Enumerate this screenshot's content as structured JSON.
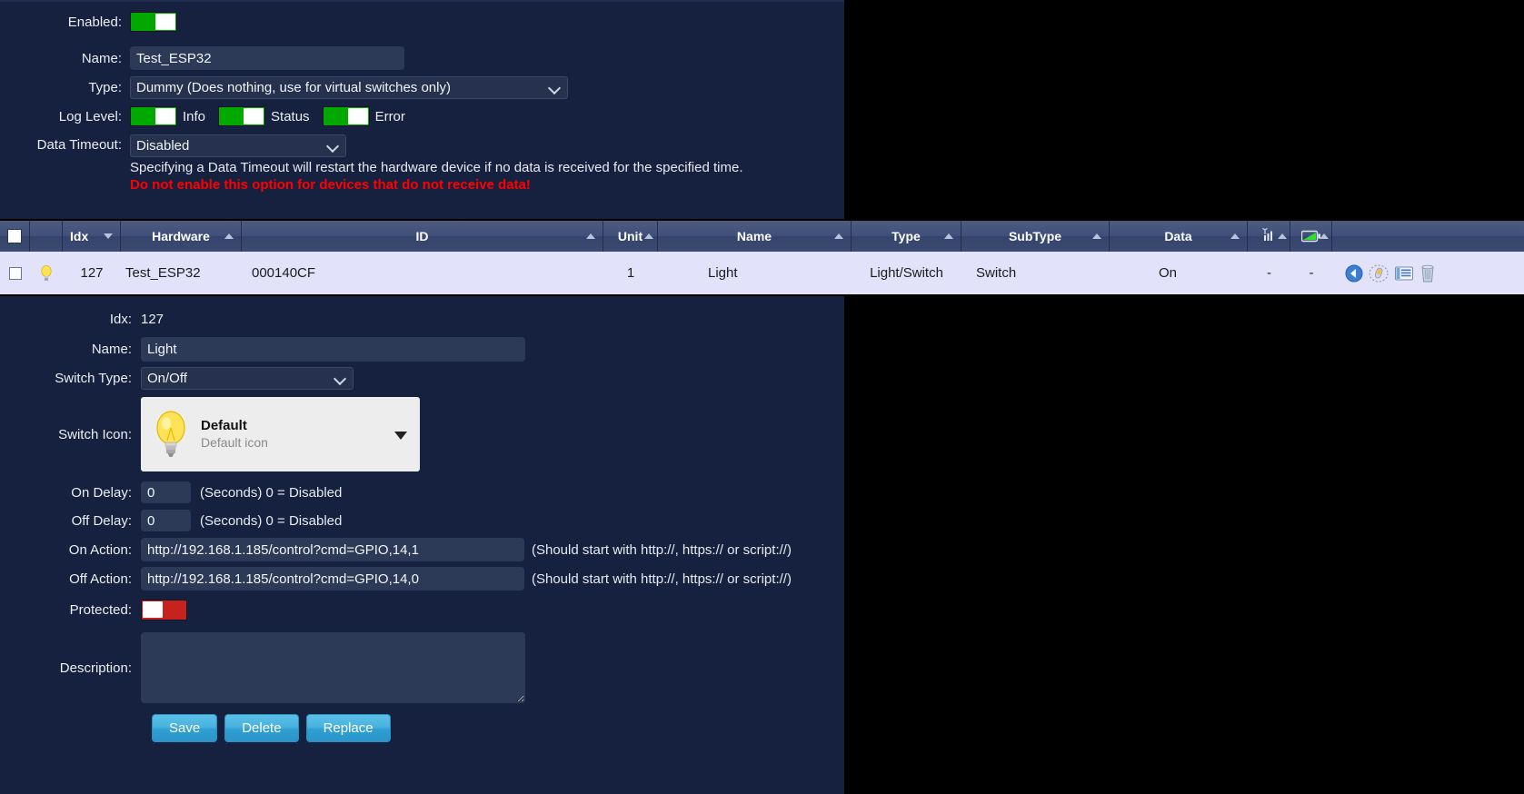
{
  "hardware_form": {
    "enabled": {
      "label": "Enabled:",
      "state": "on"
    },
    "name": {
      "label": "Name:",
      "value": "Test_ESP32"
    },
    "type": {
      "label": "Type:",
      "value": "Dummy (Does nothing, use for virtual switches only)"
    },
    "log_level": {
      "label": "Log Level:",
      "items": [
        {
          "label": "Info",
          "state": "on"
        },
        {
          "label": "Status",
          "state": "on"
        },
        {
          "label": "Error",
          "state": "on"
        }
      ]
    },
    "data_timeout": {
      "label": "Data Timeout:",
      "value": "Disabled",
      "hint": "Specifying a Data Timeout will restart the hardware device if no data is received for the specified time.",
      "warning": "Do not enable this option for devices that do not receive data!"
    }
  },
  "devices_table": {
    "columns": [
      {
        "key": "check",
        "label": "",
        "icon": "checkbox-icon",
        "sort": "none"
      },
      {
        "key": "status",
        "label": "",
        "icon": "",
        "sort": "none"
      },
      {
        "key": "idx",
        "label": "Idx",
        "sort": "desc"
      },
      {
        "key": "hardware",
        "label": "Hardware",
        "sort": "asc"
      },
      {
        "key": "id",
        "label": "ID",
        "sort": "asc"
      },
      {
        "key": "unit",
        "label": "Unit",
        "sort": "asc"
      },
      {
        "key": "name",
        "label": "Name",
        "sort": "asc"
      },
      {
        "key": "type",
        "label": "Type",
        "sort": "asc"
      },
      {
        "key": "subtype",
        "label": "SubType",
        "sort": "asc"
      },
      {
        "key": "data",
        "label": "Data",
        "sort": "asc"
      },
      {
        "key": "signal",
        "label": "",
        "icon": "signal-bars-icon",
        "sort": "asc"
      },
      {
        "key": "battery",
        "label": "",
        "icon": "battery-icon",
        "sort": "asc"
      },
      {
        "key": "actions",
        "label": "",
        "sort": "none"
      }
    ],
    "rows": [
      {
        "checked": false,
        "status_icon": "lightbulb-icon",
        "idx": "127",
        "hardware": "Test_ESP32",
        "id": "000140CF",
        "unit": "1",
        "name": "Light",
        "type": "Light/Switch",
        "subtype": "Switch",
        "data": "On",
        "signal": "-",
        "battery": "-",
        "actions": [
          "back-arrow-icon",
          "edit-pencil-icon",
          "log-list-icon",
          "delete-trash-icon"
        ]
      }
    ]
  },
  "device_form": {
    "idx": {
      "label": "Idx:",
      "value": "127"
    },
    "name": {
      "label": "Name:",
      "value": "Light"
    },
    "switch_type": {
      "label": "Switch Type:",
      "value": "On/Off"
    },
    "switch_icon": {
      "label": "Switch Icon:",
      "title": "Default",
      "subtitle": "Default icon",
      "icon": "lightbulb-icon"
    },
    "on_delay": {
      "label": "On Delay:",
      "value": "0",
      "hint": "(Seconds) 0 = Disabled"
    },
    "off_delay": {
      "label": "Off Delay:",
      "value": "0",
      "hint": "(Seconds) 0 = Disabled"
    },
    "on_action": {
      "label": "On Action:",
      "value": "http://192.168.1.185/control?cmd=GPIO,14,1",
      "hint": "(Should start with http://, https:// or script://)"
    },
    "off_action": {
      "label": "Off Action:",
      "value": "http://192.168.1.185/control?cmd=GPIO,14,0",
      "hint": "(Should start with http://, https:// or script://)"
    },
    "protected": {
      "label": "Protected:",
      "state": "off"
    },
    "description": {
      "label": "Description:",
      "value": "",
      "placeholder": ""
    },
    "buttons": {
      "save": "Save",
      "delete": "Delete",
      "replace": "Replace"
    }
  },
  "colors": {
    "panel_bg": "#16213f",
    "toggle_on": "#00a800",
    "toggle_off": "#c6231f",
    "warning_text": "#ff0000",
    "table_header": "#3d4c74",
    "table_row": "#e2e2fa",
    "button": "#36a4d4"
  }
}
